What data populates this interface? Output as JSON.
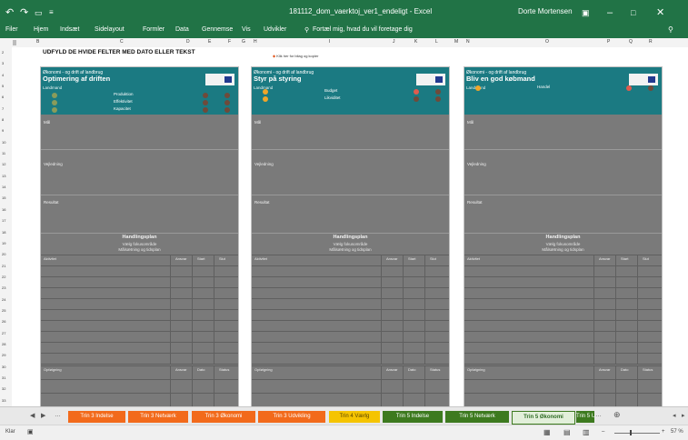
{
  "window": {
    "title": "181112_dom_vaerktoj_ver1_endeligt - Excel",
    "user": "Dorte Mortensen",
    "undo_icon": "undo-icon",
    "redo_icon": "redo-icon",
    "save_icon": "save-icon"
  },
  "ribbon": {
    "tabs": [
      "Filer",
      "Hjem",
      "Indsæt",
      "Sidelayout",
      "Formler",
      "Data",
      "Gennemse",
      "Vis",
      "Udvikler"
    ],
    "tell_me": "Fortæl mig, hvad du vil foretage dig"
  },
  "sheet": {
    "heading": "UDFYLD DE HVIDE FELTER MED DATO ELLER TEKST",
    "note": "Klik her for bilag og kopier"
  },
  "columns": [
    "B",
    "C",
    "D",
    "E",
    "F",
    "G",
    "H",
    "I",
    "J",
    "K",
    "L",
    "M",
    "N",
    "O",
    "P",
    "Q",
    "R"
  ],
  "rows": [
    "2",
    "3",
    "4",
    "5",
    "6",
    "7",
    "8",
    "9",
    "10",
    "11",
    "12",
    "13",
    "14",
    "15",
    "16",
    "17",
    "18",
    "19",
    "20",
    "21",
    "22",
    "23",
    "24",
    "25",
    "26",
    "27",
    "28",
    "29",
    "30",
    "31",
    "32",
    "33"
  ],
  "cards": [
    {
      "subtitle": "Økonomi - og drift af landbrug",
      "title": "Optimering af driften",
      "owner": "Landmand",
      "indicators": [
        "Produktion",
        "Effektivitet",
        "Kapacitet"
      ],
      "sections": [
        "Mål",
        "Vejledning",
        "Resultat"
      ],
      "plan_title": "Handlingsplan",
      "plan_sub1": "Vælg fokusområde",
      "plan_sub2": "Målsætning og tidsplan",
      "table1_cols": [
        "Aktivitet",
        "Ansvar",
        "Start",
        "Slut"
      ],
      "table2_cols": [
        "Opfølgning",
        "Ansvar",
        "Dato",
        "Status"
      ]
    },
    {
      "subtitle": "Økonomi - og drift af landbrug",
      "title": "Styr på styring",
      "owner": "Landmand",
      "indicators": [
        "Budget",
        "Likviditet"
      ],
      "sections": [
        "Mål",
        "Vejledning",
        "Resultat"
      ],
      "plan_title": "Handlingsplan",
      "plan_sub1": "Vælg fokusområde",
      "plan_sub2": "Målsætning og tidsplan",
      "table1_cols": [
        "Aktivitet",
        "Ansvar",
        "Start",
        "Slut"
      ],
      "table2_cols": [
        "Opfølgning",
        "Ansvar",
        "Dato",
        "Status"
      ]
    },
    {
      "subtitle": "Økonomi - og drift af landbrug",
      "title": "Bliv en god købmand",
      "owner": "Landmand",
      "indicators": [
        "Handel"
      ],
      "sections": [
        "Mål",
        "Vejledning",
        "Resultat"
      ],
      "plan_title": "Handlingsplan",
      "plan_sub1": "Vælg fokusområde",
      "plan_sub2": "Målsætning og tidsplan",
      "table1_cols": [
        "Aktivitet",
        "Ansvar",
        "Start",
        "Slut"
      ],
      "table2_cols": [
        "Opfølgning",
        "Ansvar",
        "Dato",
        "Status"
      ]
    }
  ],
  "sheet_tabs": [
    {
      "label": "Trin 3 Indelse",
      "color": "#f26a1b"
    },
    {
      "label": "Trin 3 Netværk",
      "color": "#f26a1b"
    },
    {
      "label": "Trin 3 Økonomi",
      "color": "#f26a1b"
    },
    {
      "label": "Trin 3 Udvikling",
      "color": "#f26a1b"
    },
    {
      "label": "Trin 4 Værlg",
      "color": "#f5c400"
    },
    {
      "label": "Trin 5 Indelse",
      "color": "#3d7a1f"
    },
    {
      "label": "Trin 5 Netværk",
      "color": "#3d7a1f"
    },
    {
      "label": "Trin 5 Økonomi",
      "color": "#e2efda"
    },
    {
      "label": "Trin 5 Udvi",
      "color": "#3d7a1f"
    }
  ],
  "status": {
    "mode": "Klar",
    "zoom": "57 %"
  },
  "colors": {
    "excel_green": "#217346",
    "card_header": "#1b7a82",
    "card_body": "#7a7a7a"
  }
}
